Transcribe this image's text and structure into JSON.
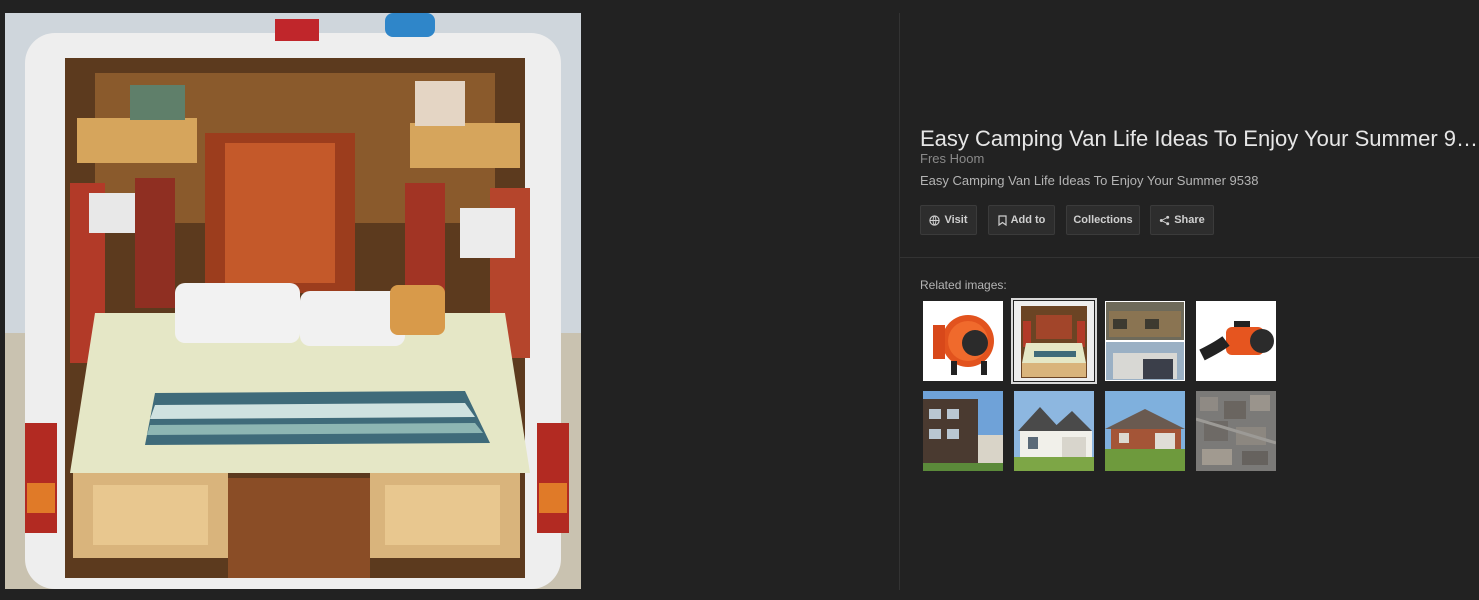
{
  "main_image": {
    "alt": "Van interior with bed and cabinets"
  },
  "details": {
    "title": "Easy Camping Van Life Ideas To Enjoy Your Summer 95...",
    "source": "Fres Hoom",
    "description": "Easy Camping Van Life Ideas To Enjoy Your Summer 9538"
  },
  "actions": {
    "visit": "Visit",
    "add_to": "Add to",
    "collections": "Collections",
    "share": "Share"
  },
  "related": {
    "label": "Related images:",
    "thumbnails": [
      {
        "subject": "orange fan",
        "selected": false
      },
      {
        "subject": "van interior",
        "selected": true
      },
      {
        "subject": "house collage",
        "selected": false
      },
      {
        "subject": "orange fan with duct",
        "selected": false
      },
      {
        "subject": "brick apartment",
        "selected": false
      },
      {
        "subject": "white house",
        "selected": false
      },
      {
        "subject": "brick house",
        "selected": false
      },
      {
        "subject": "aerial city",
        "selected": false
      }
    ]
  },
  "colors": {
    "background": "#222222",
    "panel_text": "#e6e6e6",
    "muted_text": "#8a8a8a",
    "button_bg": "#2d2d2d"
  }
}
